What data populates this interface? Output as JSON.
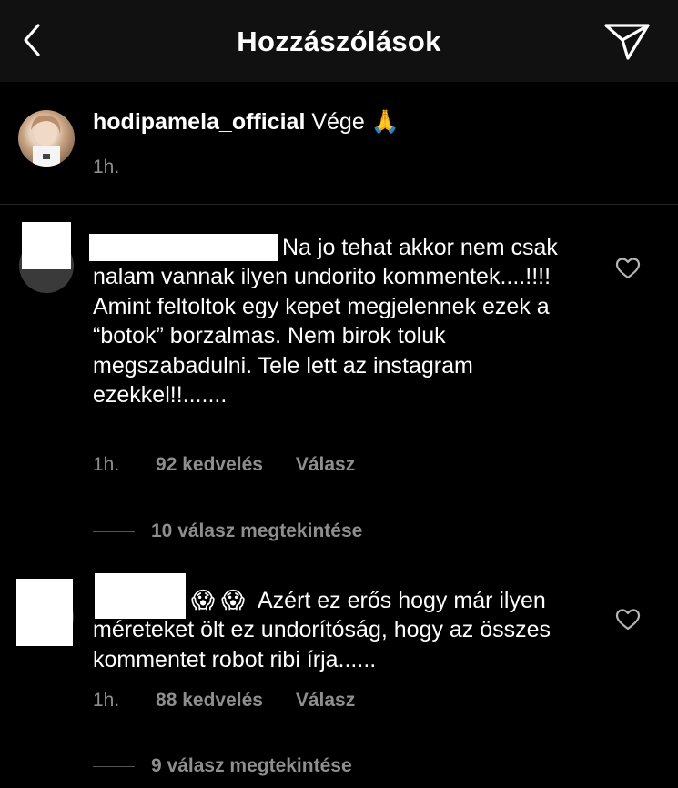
{
  "header": {
    "title": "Hozzászólások",
    "back_icon": "chevron-left-icon",
    "send_icon": "paper-plane-icon"
  },
  "caption": {
    "username": "hodipamela_official",
    "text": "Vége",
    "emoji": "🙏",
    "time": "1h."
  },
  "comments": [
    {
      "text": "Na jo tehat akkor nem csak nalam vannak ilyen undorito kommentek....!!!! Amint feltoltok egy kepet megjelennek ezek a “botok” borzalmas. Nem birok toluk megszabadulni. Tele lett az instagram ezekkel!!.......",
      "time": "1h.",
      "likes": "92 kedvelés",
      "reply": "Válasz",
      "view_replies": "10 válasz megtekintése"
    },
    {
      "emojis": "😱 😱",
      "text": "Azért ez erős hogy már ilyen méreteket ölt ez undorítóság, hogy az összes kommentet robot ribi írja......",
      "time": "1h.",
      "likes": "88 kedvelés",
      "reply": "Válasz",
      "view_replies": "9 válasz megtekintése"
    }
  ],
  "colors": {
    "background": "#000000",
    "header": "#111111",
    "muted": "#8e8e8e"
  }
}
